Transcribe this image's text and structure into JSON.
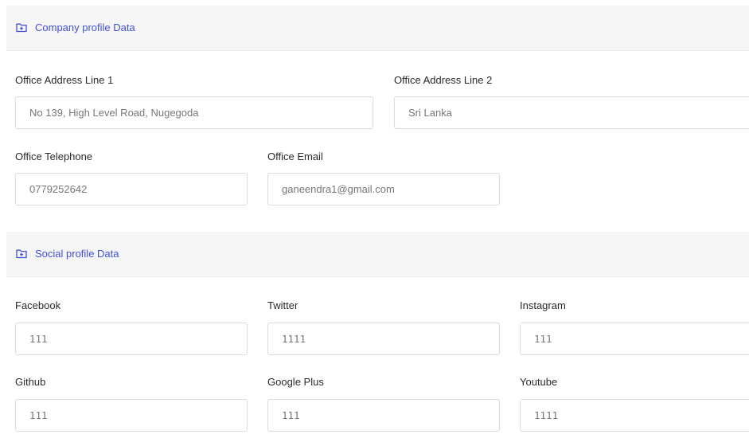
{
  "company_section": {
    "title": "Company profile Data",
    "icon": "folder-plus-icon",
    "fields": {
      "address1": {
        "label": "Office Address Line 1",
        "value": "No 139, High Level Road, Nugegoda"
      },
      "address2": {
        "label": "Office Address Line 2",
        "value": "Sri Lanka"
      },
      "telephone": {
        "label": "Office Telephone",
        "value": "0779252642"
      },
      "email": {
        "label": "Office Email",
        "value": "ganeendra1@gmail.com"
      }
    }
  },
  "social_section": {
    "title": "Social profile Data",
    "icon": "folder-plus-icon",
    "fields": {
      "facebook": {
        "label": "Facebook",
        "value": "111"
      },
      "twitter": {
        "label": "Twitter",
        "value": "1111"
      },
      "instagram": {
        "label": "Instagram",
        "value": "111"
      },
      "github": {
        "label": "Github",
        "value": "111"
      },
      "googleplus": {
        "label": "Google Plus",
        "value": "111"
      },
      "youtube": {
        "label": "Youtube",
        "value": "1111"
      }
    }
  },
  "colors": {
    "accent": "#3f51d8",
    "header_bg": "#f6f6f7",
    "border": "#dcdcdc"
  }
}
